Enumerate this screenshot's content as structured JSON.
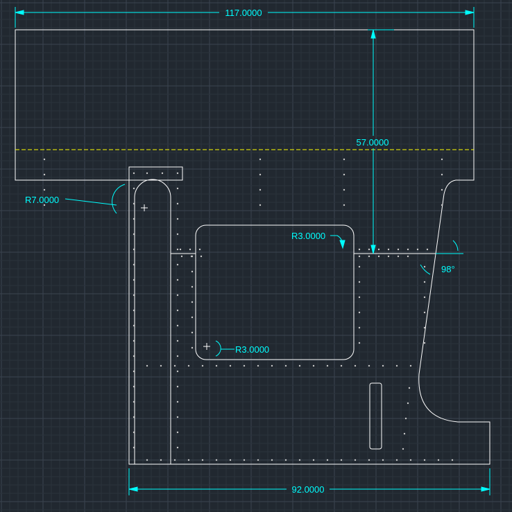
{
  "colors": {
    "background": "#212830",
    "grid_minor": "#2b333c",
    "grid_major": "#3a4450",
    "geometry": "#ffffff",
    "dimension": "#00ffff",
    "centerline": "#ffff00",
    "hole": "#c8c8c8"
  },
  "dimensions": {
    "overall_width": "117.0000",
    "height": "57.0000",
    "bottom_width": "92.0000",
    "radius_slot": "R7.0000",
    "radius_top": "R3.0000",
    "radius_bottom": "R3.0000",
    "angle": "98°"
  }
}
